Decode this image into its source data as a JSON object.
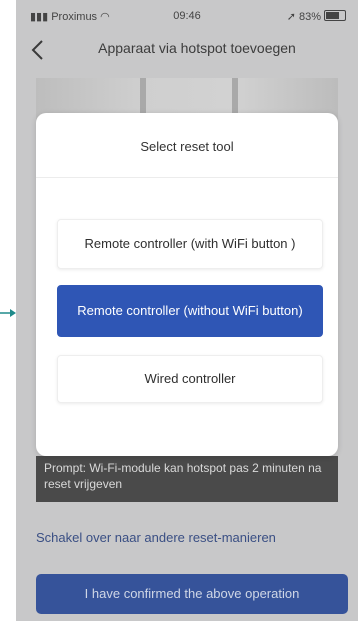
{
  "status_bar": {
    "carrier": "Proximus",
    "time": "09:46",
    "battery": "83%"
  },
  "nav": {
    "title": "Apparaat via hotspot toevoegen",
    "back_icon": "chevron-left-icon"
  },
  "modal": {
    "title": "Select reset tool",
    "options": [
      {
        "label": "Remote controller (with WiFi button )",
        "selected": false
      },
      {
        "label": "Remote controller (without WiFi button)",
        "selected": true
      },
      {
        "label": "Wired controller",
        "selected": false
      }
    ]
  },
  "background": {
    "prompt": "Prompt: Wi-Fi-module kan hotspot pas 2 minuten na reset vrijgeven",
    "switch_link": "Schakel over naar andere reset-manieren",
    "confirm_button": "I have confirmed the above operation"
  },
  "colors": {
    "primary": "#2f56b5",
    "overlay": "#c8c8c9",
    "arrow": "#1f8a8a"
  }
}
